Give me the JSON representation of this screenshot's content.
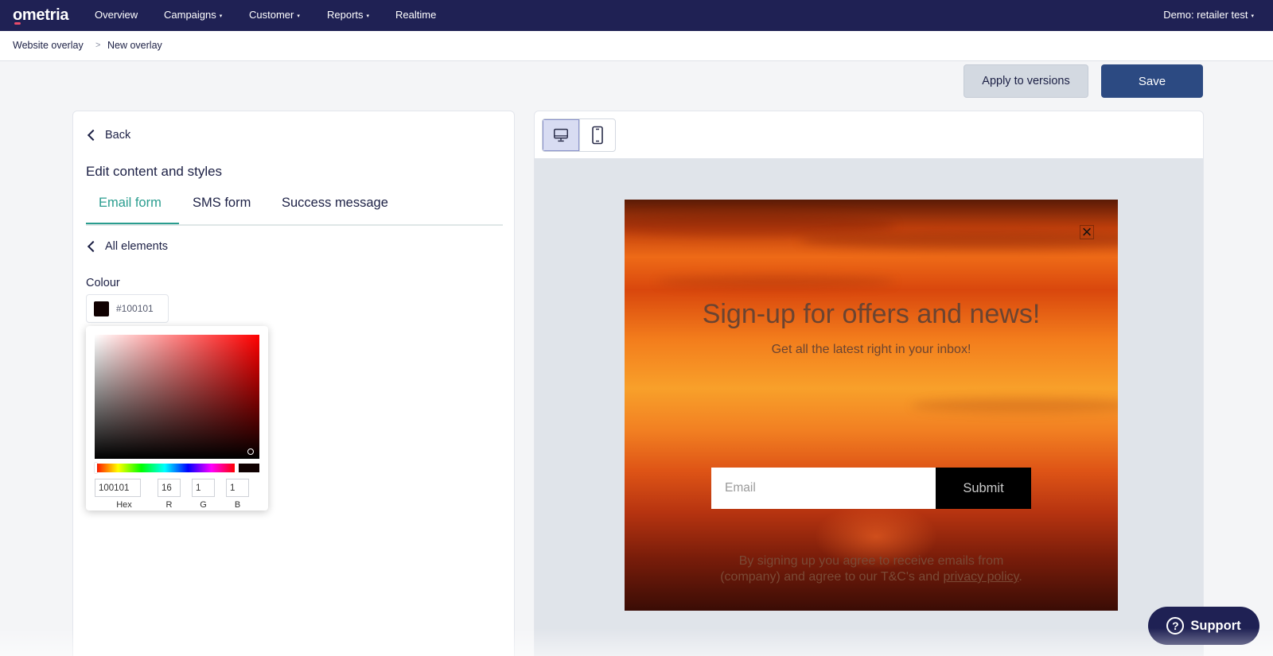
{
  "nav": {
    "logo": "ometria",
    "items": [
      {
        "label": "Overview",
        "has_dropdown": false
      },
      {
        "label": "Campaigns",
        "has_dropdown": true
      },
      {
        "label": "Customer",
        "has_dropdown": true
      },
      {
        "label": "Reports",
        "has_dropdown": true
      },
      {
        "label": "Realtime",
        "has_dropdown": false
      }
    ],
    "account": "Demo: retailer test",
    "caret": "▾"
  },
  "breadcrumb": {
    "items": [
      "Website overlay",
      "New overlay"
    ],
    "separator": ">"
  },
  "actions": {
    "apply_label": "Apply to versions",
    "save_label": "Save"
  },
  "editor": {
    "back_label": "Back",
    "title": "Edit content and styles",
    "tabs": [
      {
        "label": "Email form",
        "active": true
      },
      {
        "label": "SMS form",
        "active": false
      },
      {
        "label": "Success message",
        "active": false
      }
    ],
    "all_elements_label": "All elements",
    "colour_label": "Colour",
    "colour_value": "#100101",
    "colour_hex": "#100101"
  },
  "picker": {
    "hex": "100101",
    "r": "16",
    "g": "1",
    "b": "1",
    "labels": {
      "hex": "Hex",
      "r": "R",
      "g": "G",
      "b": "B"
    }
  },
  "preview": {
    "device": "desktop",
    "overlay": {
      "close_glyph": "×",
      "title": "Sign-up for offers and news!",
      "subtitle": "Get all the latest right in your inbox!",
      "email_placeholder": "Email",
      "submit_label": "Submit",
      "terms_line1": "By signing up you agree to receive emails from",
      "terms_line2_prefix": "(company) and agree to our T&C's and ",
      "terms_link": "privacy policy",
      "terms_suffix": "."
    }
  },
  "support": {
    "label": "Support",
    "icon_glyph": "?"
  },
  "colors": {
    "nav_bg": "#1f2154",
    "accent": "#2a9d8f",
    "save_bg": "#2c4a82",
    "apply_bg": "#d3d9e1"
  }
}
